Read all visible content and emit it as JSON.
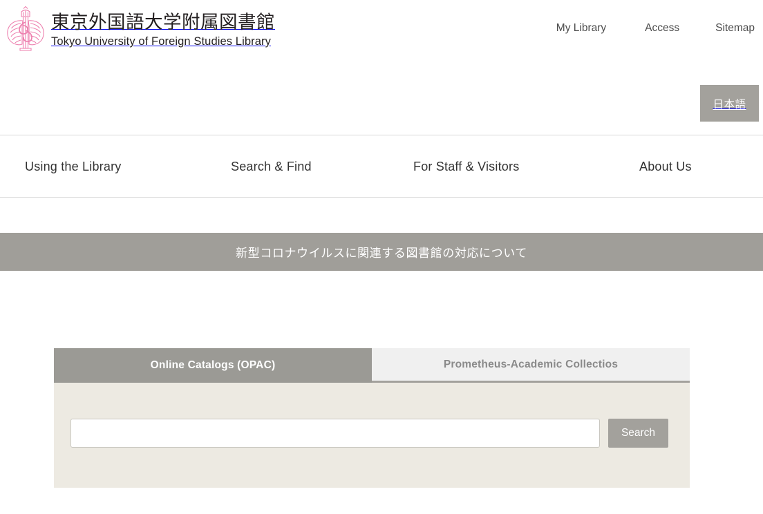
{
  "header": {
    "logo_icon": "tufs-winged-emblem-logo",
    "brand_jp": "東京外国語大学附属図書館",
    "brand_en": "Tokyo University of Foreign Studies Library",
    "utility_links": [
      {
        "label": "My Library"
      },
      {
        "label": "Access"
      },
      {
        "label": "Sitemap"
      }
    ],
    "language_toggle": {
      "label": "日本語"
    }
  },
  "main_nav": {
    "items": [
      {
        "label": "Using the Library"
      },
      {
        "label": "Search & Find"
      },
      {
        "label": "For Staff & Visitors"
      },
      {
        "label": "About Us"
      }
    ]
  },
  "notice": {
    "text": "新型コロナウイルスに関連する図書館の対応について"
  },
  "search_widget": {
    "tabs": [
      {
        "label": "Online Catalogs (OPAC)",
        "active": true
      },
      {
        "label": "Prometheus-Academic Collectios",
        "active": false
      }
    ],
    "input": {
      "value": "",
      "placeholder": ""
    },
    "submit_label": "Search"
  },
  "colors": {
    "brand_pink": "#ED7FAE",
    "accent_gray": "#a3a19c",
    "active_tab_gray": "#9b9a95",
    "inactive_tab_gray": "#f0f0f0",
    "panel_beige": "#edeae2",
    "banner_gray": "#a09e99",
    "text_dark": "#333333"
  }
}
